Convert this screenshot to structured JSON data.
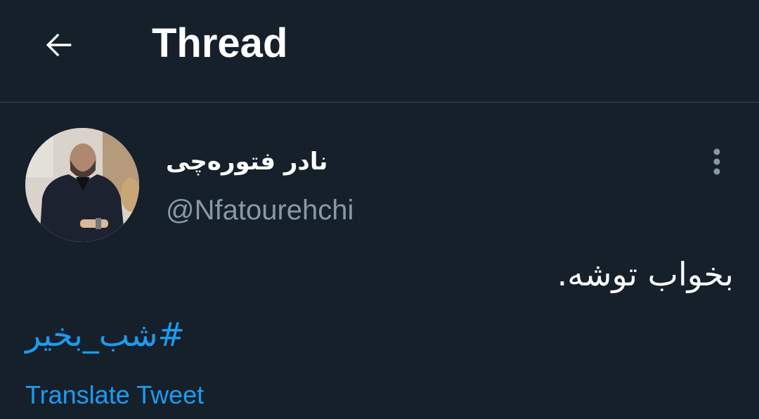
{
  "header": {
    "title": "Thread",
    "back_icon": "arrow-left-icon"
  },
  "tweet": {
    "author": {
      "display_name": "نادر فتوره‌چی",
      "handle": "@Nfatourehchi",
      "avatar_icon": "profile-photo"
    },
    "more_icon": "more-vertical-icon",
    "text": "بخواب توشه.",
    "hashtag": "#شب_بخیر",
    "translate_label": "Translate Tweet"
  },
  "colors": {
    "background": "#15202b",
    "divider": "#38444d",
    "text_primary": "#ffffff",
    "text_secondary": "#8899a6",
    "link": "#1d9bf0"
  }
}
